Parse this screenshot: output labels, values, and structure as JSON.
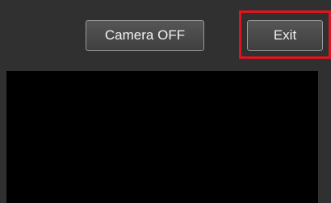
{
  "toolbar": {
    "camera_button_label": "Camera OFF",
    "exit_button_label": "Exit"
  },
  "colors": {
    "background": "#303030",
    "video": "#000000",
    "highlight": "#e0141e"
  }
}
